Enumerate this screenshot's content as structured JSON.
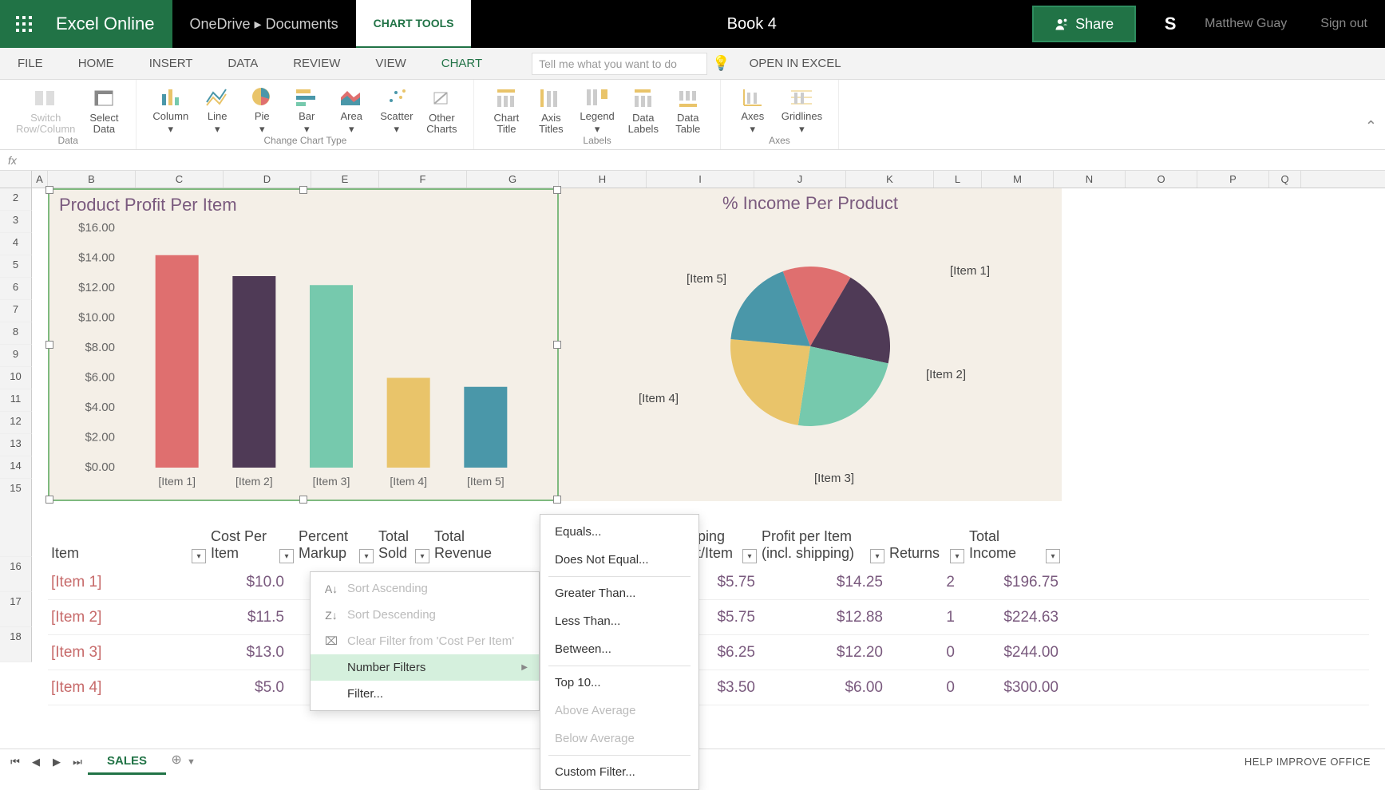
{
  "app": {
    "name": "Excel Online",
    "breadcrumb": "OneDrive  ▸  Documents",
    "contextual": "CHART TOOLS",
    "doc": "Book 4",
    "share": "Share",
    "user": "Matthew Guay",
    "signout": "Sign out"
  },
  "tabs": {
    "file": "FILE",
    "home": "HOME",
    "insert": "INSERT",
    "data": "DATA",
    "review": "REVIEW",
    "view": "VIEW",
    "chart": "CHART",
    "tellme": "Tell me what you want to do",
    "open": "OPEN IN EXCEL"
  },
  "ribbon": {
    "switch": "Switch\nRow/Column",
    "select": "Select\nData",
    "group_data": "Data",
    "column": "Column",
    "line": "Line",
    "pie": "Pie",
    "bar": "Bar",
    "area": "Area",
    "scatter": "Scatter",
    "other": "Other\nCharts",
    "group_type": "Change Chart Type",
    "chart_title": "Chart\nTitle",
    "axis_titles": "Axis\nTitles",
    "legend": "Legend",
    "data_labels": "Data\nLabels",
    "data_table": "Data\nTable",
    "group_labels": "Labels",
    "axes": "Axes",
    "gridlines": "Gridlines",
    "group_axes": "Axes"
  },
  "columns": [
    "A",
    "B",
    "C",
    "D",
    "E",
    "F",
    "G",
    "H",
    "I",
    "J",
    "K",
    "L",
    "M",
    "N",
    "O",
    "P",
    "Q"
  ],
  "rows": [
    "2",
    "3",
    "4",
    "5",
    "6",
    "7",
    "8",
    "9",
    "10",
    "11",
    "12",
    "13",
    "14",
    "15",
    "16",
    "17",
    "18"
  ],
  "chart_data": [
    {
      "type": "bar",
      "title": "Product Profit Per Item",
      "categories": [
        "[Item 1]",
        "[Item 2]",
        "[Item 3]",
        "[Item 4]",
        "[Item 5]"
      ],
      "values": [
        14.2,
        12.8,
        12.2,
        6.0,
        5.4
      ],
      "ylim": [
        0,
        16
      ],
      "ystep": 2,
      "yticks": [
        "$0.00",
        "$2.00",
        "$4.00",
        "$6.00",
        "$8.00",
        "$10.00",
        "$12.00",
        "$14.00",
        "$16.00"
      ],
      "colors": [
        "#df6f6f",
        "#4f3a56",
        "#76c9ad",
        "#e9c46a",
        "#4a97a9"
      ]
    },
    {
      "type": "pie",
      "title": "% Income Per Product",
      "categories": [
        "[Item 1]",
        "[Item 2]",
        "[Item 3]",
        "[Item 4]",
        "[Item 5]"
      ],
      "values": [
        14,
        20,
        24,
        24,
        18
      ],
      "colors": [
        "#df6f6f",
        "#4f3a56",
        "#76c9ad",
        "#e9c46a",
        "#4a97a9"
      ]
    }
  ],
  "table": {
    "headers": {
      "item": "Item",
      "cost": "Cost Per Item",
      "markup": "Percent Markup",
      "sold": "Total Sold",
      "revenue": "Total Revenue",
      "ship": "Shipping",
      "shipcost": "pping\nst/Item",
      "profit": "Profit per Item\n(incl. shipping)",
      "returns": "Returns",
      "income": "Total\nIncome"
    },
    "rows": [
      {
        "item": "[Item 1]",
        "cost": "$10.0",
        "shipcost": "$5.75",
        "profit": "$14.25",
        "returns": "2",
        "income": "$196.75"
      },
      {
        "item": "[Item 2]",
        "cost": "$11.5",
        "shipcost": "$5.75",
        "profit": "$12.88",
        "returns": "1",
        "income": "$224.63"
      },
      {
        "item": "[Item 3]",
        "cost": "$13.0",
        "shipcost": "$6.25",
        "profit": "$12.20",
        "returns": "0",
        "income": "$244.00"
      },
      {
        "item": "[Item 4]",
        "cost": "$5.0",
        "shipcost": "$3.50",
        "profit": "$6.00",
        "returns": "0",
        "income": "$300.00"
      }
    ]
  },
  "menu1": {
    "sort_asc": "Sort Ascending",
    "sort_desc": "Sort Descending",
    "clear": "Clear Filter from 'Cost Per Item'",
    "numfilter": "Number Filters",
    "filter": "Filter..."
  },
  "menu2": {
    "equals": "Equals...",
    "notequal": "Does Not Equal...",
    "greater": "Greater Than...",
    "less": "Less Than...",
    "between": "Between...",
    "top10": "Top 10...",
    "above": "Above Average",
    "below": "Below Average",
    "custom": "Custom Filter..."
  },
  "status": {
    "sheet": "SALES",
    "help": "HELP IMPROVE OFFICE"
  }
}
